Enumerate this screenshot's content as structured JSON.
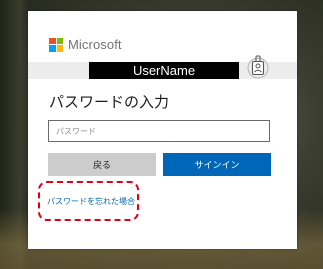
{
  "brand": {
    "name": "Microsoft"
  },
  "account": {
    "username": "UserName",
    "badge_icon": "id-badge-icon"
  },
  "title": "パスワードの入力",
  "password": {
    "value": "",
    "placeholder": "パスワード"
  },
  "buttons": {
    "back_label": "戻る",
    "signin_label": "サインイン"
  },
  "forgot_link": "パスワードを忘れた場合",
  "colors": {
    "primary": "#0067b8",
    "secondary_button": "#cccccc",
    "highlight": "#e0001a",
    "logo": [
      "#f25022",
      "#7fba00",
      "#00a4ef",
      "#ffb900"
    ]
  }
}
